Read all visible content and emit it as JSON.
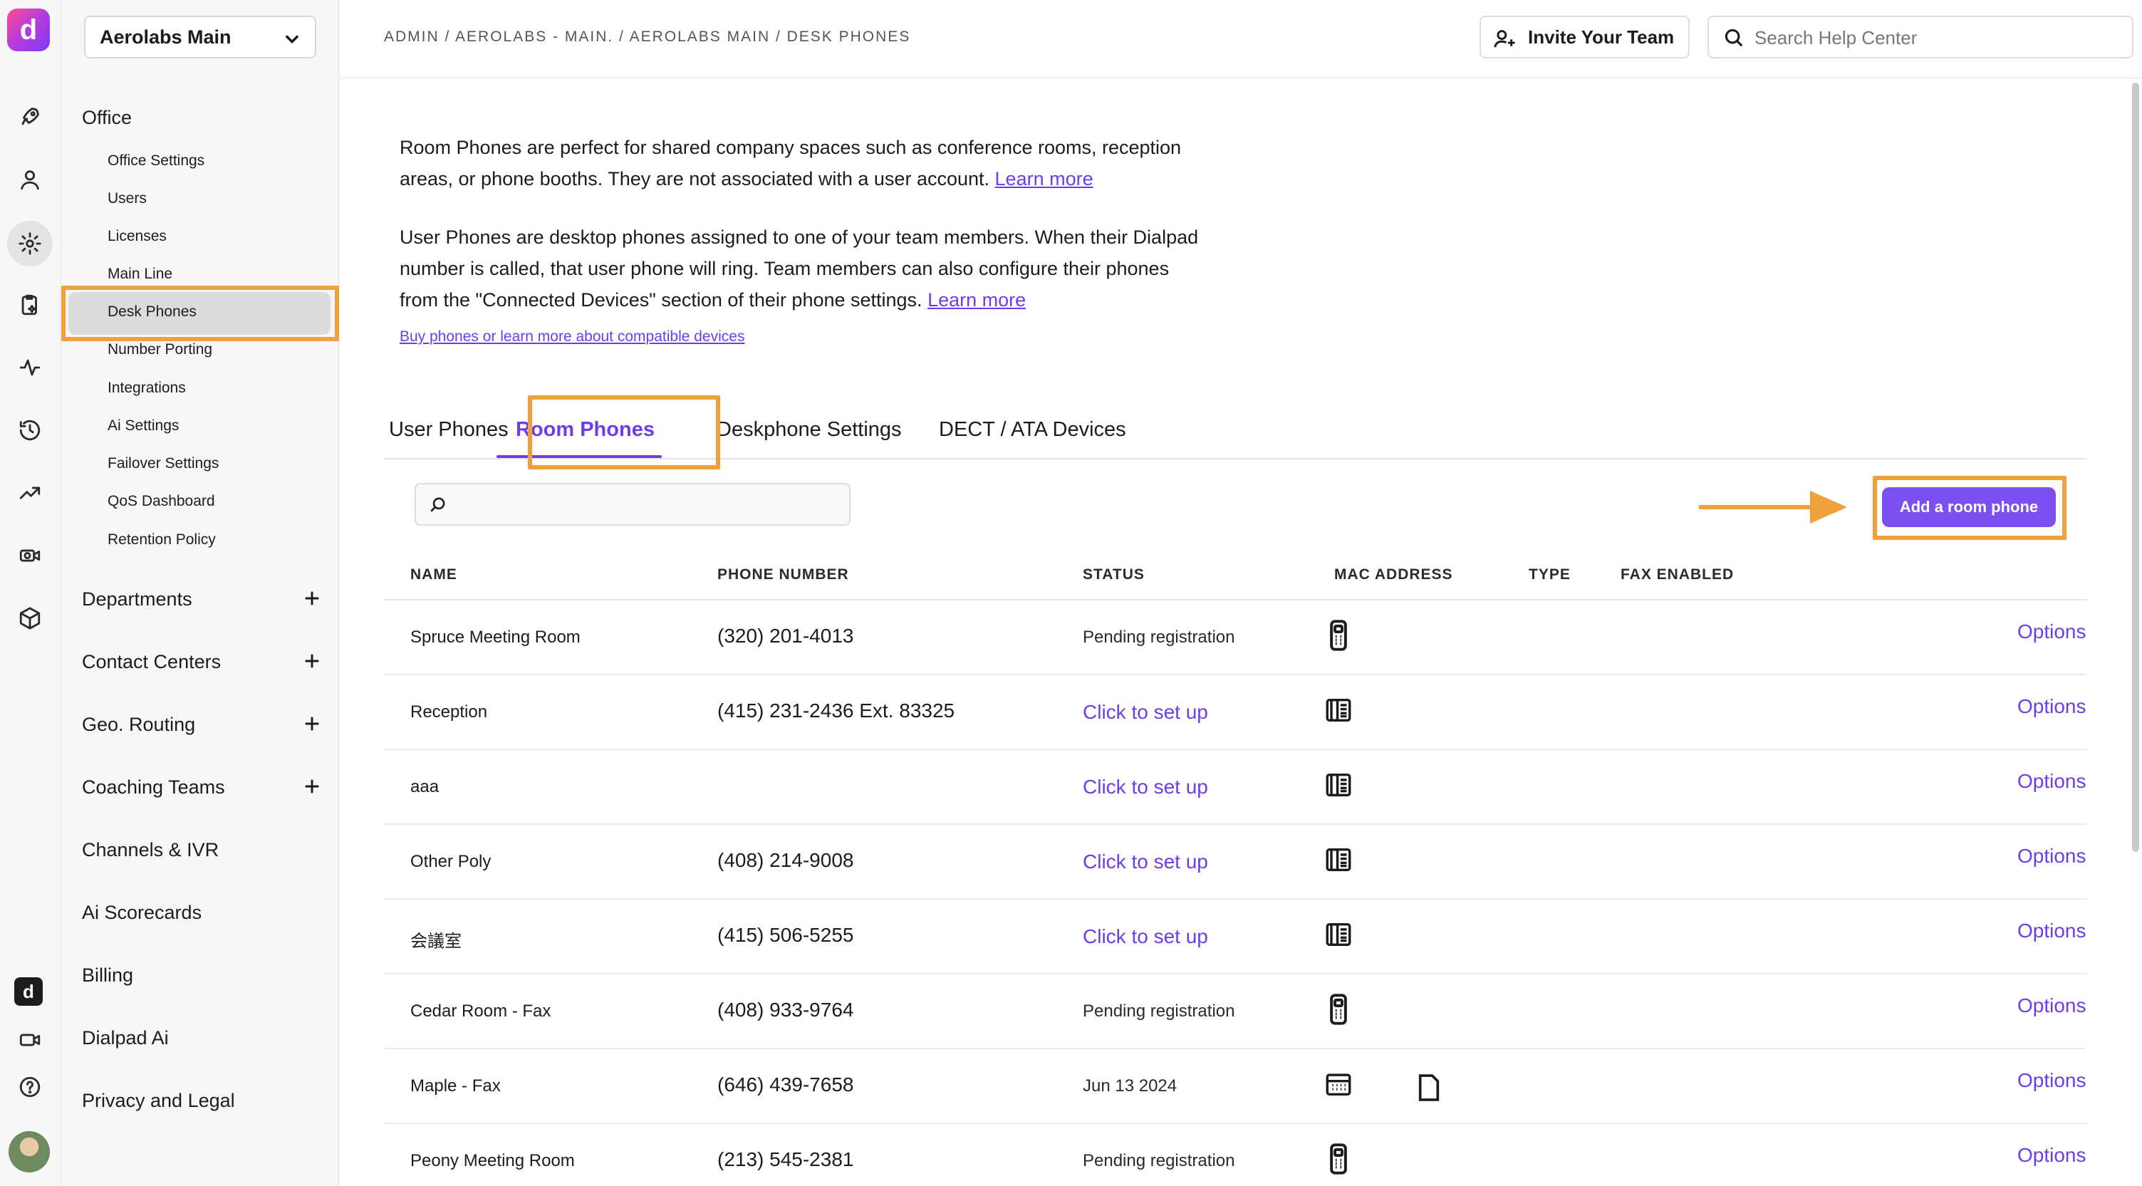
{
  "rail": {
    "logo_glyph": "d",
    "icons": [
      "rocket-icon",
      "user-icon",
      "gear-icon",
      "clipboard-sparkle-icon",
      "activity-icon",
      "history-icon",
      "trend-icon",
      "camera-icon",
      "cube-icon"
    ],
    "bottom_icons": [
      "dialpad-ai-icon",
      "video-icon",
      "help-icon"
    ],
    "ai_badge": "d"
  },
  "sidebar": {
    "org_name": "Aerolabs Main",
    "office_title": "Office",
    "office_items": [
      "Office Settings",
      "Users",
      "Licenses",
      "Main Line",
      "Desk Phones",
      "Number Porting",
      "Integrations",
      "Ai Settings",
      "Failover Settings",
      "QoS Dashboard",
      "Retention Policy"
    ],
    "expandable_sections": [
      "Departments",
      "Contact Centers",
      "Geo. Routing",
      "Coaching Teams"
    ],
    "sections": [
      "Channels & IVR",
      "Ai Scorecards",
      "Billing",
      "Dialpad Ai",
      "Privacy and Legal"
    ]
  },
  "header": {
    "breadcrumb": "ADMIN / AEROLABS - MAIN. / AEROLABS MAIN / DESK PHONES",
    "invite_label": "Invite Your Team",
    "search_placeholder": "Search Help Center"
  },
  "intro": {
    "room_text": "Room Phones are perfect for shared company spaces such as conference rooms, reception areas, or phone booths. They are not associated with a user account.",
    "user_text": "User Phones are desktop phones assigned to one of your team members. When their Dialpad number is called, that user phone will ring. Team members can also configure their phones from the \"Connected Devices\" section of their phone settings.",
    "learn_more": "Learn more",
    "buy_link": "Buy phones or learn more about compatible devices"
  },
  "tabs": [
    "User Phones",
    "Room Phones",
    "Deskphone Settings",
    "DECT / ATA Devices"
  ],
  "active_tab": "Room Phones",
  "add_button": "Add a room phone",
  "table": {
    "columns": [
      "NAME",
      "PHONE NUMBER",
      "STATUS",
      "MAC ADDRESS",
      "TYPE",
      "FAX ENABLED"
    ],
    "options_label": "Options",
    "rows": [
      {
        "name": "Spruce Meeting Room",
        "phone": "(320) 201-4013",
        "status": "Pending registration",
        "status_link": false,
        "type": "mobile",
        "fax": false
      },
      {
        "name": "Reception",
        "phone": "(415) 231-2436 Ext. 83325",
        "status": "Click to set up",
        "status_link": true,
        "type": "desk",
        "fax": false
      },
      {
        "name": "aaa",
        "phone": "",
        "status": "Click to set up",
        "status_link": true,
        "type": "desk",
        "fax": false
      },
      {
        "name": "Other Poly",
        "phone": "(408) 214-9008",
        "status": "Click to set up",
        "status_link": true,
        "type": "desk",
        "fax": false
      },
      {
        "name": "会議室",
        "phone": "(415) 506-5255",
        "status": "Click to set up",
        "status_link": true,
        "type": "desk",
        "fax": false
      },
      {
        "name": "Cedar Room - Fax",
        "phone": "(408) 933-9764",
        "status": "Pending registration",
        "status_link": false,
        "type": "mobile",
        "fax": false
      },
      {
        "name": "Maple - Fax",
        "phone": "(646) 439-7658",
        "status": "Jun 13 2024",
        "status_link": false,
        "type": "fax",
        "fax": true
      },
      {
        "name": "Peony Meeting Room",
        "phone": "(213) 545-2381",
        "status": "Pending registration",
        "status_link": false,
        "type": "mobile",
        "fax": false
      }
    ]
  },
  "colors": {
    "accent": "#6c3eea",
    "button": "#7c4ff0",
    "highlight": "#f0a03c"
  }
}
